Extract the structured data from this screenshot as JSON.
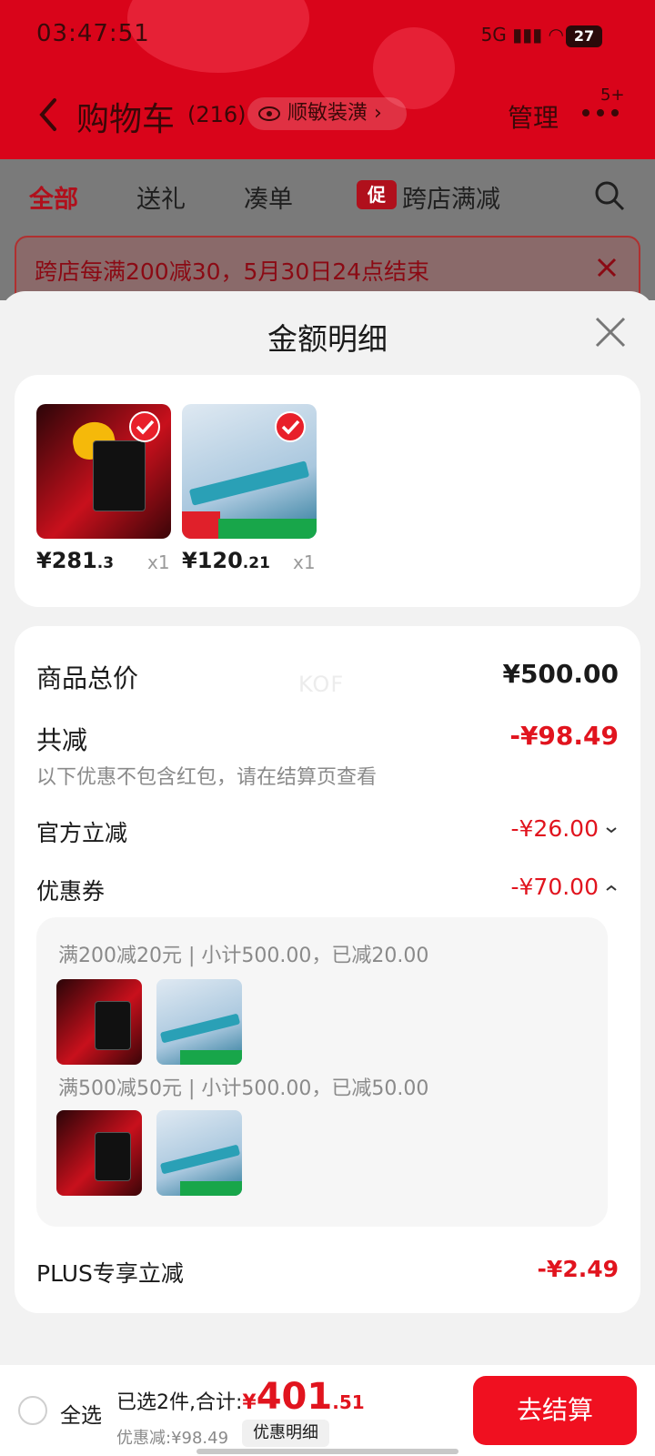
{
  "status_bar": {
    "time": "03:47:51",
    "signal": "5G",
    "battery": "27"
  },
  "header": {
    "title": "购物车",
    "count": "(216)",
    "sensitive_label": "顺敏装潢",
    "manage_label": "管理",
    "more_badge": "5+"
  },
  "tabs": [
    {
      "label": "全部",
      "active": true
    },
    {
      "label": "送礼",
      "active": false
    },
    {
      "label": "凑单",
      "active": false
    },
    {
      "label": "跨店满减",
      "active": false,
      "tag": "促"
    }
  ],
  "banner": {
    "text": "跨店每满200减30，5月30日24点结束"
  },
  "sheet": {
    "title": "金额明细",
    "products": [
      {
        "price_int": "¥281",
        "price_dec": ".3",
        "qty": "x1",
        "image": "ssd-icon"
      },
      {
        "price_int": "¥120",
        "price_dec": ".21",
        "qty": "x1",
        "image": "power-strip-icon"
      }
    ],
    "watermark": "KOF",
    "total": {
      "label": "商品总价",
      "value": "¥500.00"
    },
    "reduce": {
      "label": "共减",
      "value": "-¥98.49",
      "note": "以下优惠不包含红包，请在结算页查看"
    },
    "official": {
      "label": "官方立减",
      "value": "-¥26.00"
    },
    "coupon": {
      "label": "优惠券",
      "value": "-¥70.00",
      "items": [
        {
          "text": "满200减20元 | 小计500.00，已减20.00"
        },
        {
          "text": "满500减50元 | 小计500.00，已减50.00"
        }
      ]
    },
    "plus": {
      "label": "PLUS专享立减",
      "value": "-¥2.49"
    }
  },
  "bottom_bar": {
    "select_all": "全选",
    "selected_text": "已选2件,合计:",
    "yen": "¥",
    "total_int": "401",
    "total_dec": ".51",
    "discount_text": "优惠减:¥98.49",
    "detail_button": "优惠明细",
    "checkout_button": "去结算"
  },
  "colors": {
    "brand_red": "#e1141e",
    "header_red": "#d9041a",
    "checkout_red": "#f01020"
  }
}
